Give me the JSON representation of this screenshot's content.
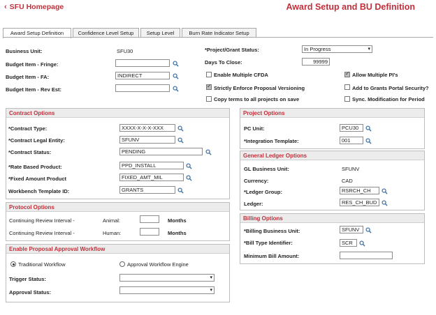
{
  "header": {
    "home_link": "SFU Homepage",
    "page_title": "Award Setup and BU Definition"
  },
  "tabs": [
    {
      "label": "Award Setup Definition",
      "active": true
    },
    {
      "label": "Confidence Level Setup",
      "active": false
    },
    {
      "label": "Setup Level",
      "active": false
    },
    {
      "label": "Burn Rate Indicator Setup",
      "active": false
    }
  ],
  "general": {
    "business_unit_label": "Business Unit:",
    "business_unit_value": "SFU30",
    "budget_fringe_label": "Budget Item - Fringe:",
    "budget_fringe_value": "",
    "budget_fa_label": "Budget Item - FA:",
    "budget_fa_value": "INDIRECT",
    "budget_rev_label": "Budget Item - Rev Est:",
    "budget_rev_value": "",
    "project_status_label": "*Project/Grant Status:",
    "project_status_value": "In Progress",
    "days_to_close_label": "Days To Close:",
    "days_to_close_value": "99999",
    "enable_multiple_cfda_label": "Enable Multiple CFDA",
    "enable_multiple_cfda_checked": false,
    "allow_multiple_pis_label": "Allow Multiple PI's",
    "allow_multiple_pis_checked": true,
    "strict_versioning_label": "Strictly Enforce Proposal Versioning",
    "strict_versioning_checked": true,
    "add_portal_label": "Add to Grants Portal Security?",
    "add_portal_checked": false,
    "copy_terms_label": "Copy terms to all projects on save",
    "copy_terms_checked": false,
    "sync_mod_label": "Sync. Modification for Period",
    "sync_mod_checked": false
  },
  "contract_options": {
    "title": "Contract Options",
    "contract_type_label": "*Contract Type:",
    "contract_type_value": "XXXX-X-X-X-XXX",
    "legal_entity_label": "*Contract Legal Entity:",
    "legal_entity_value": "SFUNV",
    "contract_status_label": "*Contract Status:",
    "contract_status_value": "PENDING",
    "rate_based_label": "*Rate Based Product:",
    "rate_based_value": "PPD_INSTALL",
    "fixed_amount_label": "*Fixed Amount Product",
    "fixed_amount_value": "FIXED_AMT_MIL",
    "workbench_label": "Workbench Template ID:",
    "workbench_value": "GRANTS"
  },
  "protocol_options": {
    "title": "Protocol Options",
    "row1_label": "Continuing Review Interval -",
    "row1_sub": "Animal:",
    "row1_value": "",
    "row1_unit": "Months",
    "row2_label": "Continuing Review Interval -",
    "row2_sub": "Human:",
    "row2_value": "",
    "row2_unit": "Months"
  },
  "workflow": {
    "title": "Enable Proposal Approval Workflow",
    "traditional_label": "Traditional Workflow",
    "traditional_selected": true,
    "engine_label": "Approval Workflow Engine",
    "engine_selected": false,
    "trigger_label": "Trigger Status:",
    "trigger_value": "",
    "approval_label": "Approval Status:",
    "approval_value": ""
  },
  "project_options": {
    "title": "Project Options",
    "pc_unit_label": "PC Unit:",
    "pc_unit_value": "PCU30",
    "integration_label": "*Integration Template:",
    "integration_value": "001"
  },
  "gl_options": {
    "title": "General Ledger Options",
    "gl_bu_label": "GL Business Unit:",
    "gl_bu_value": "SFUNV",
    "currency_label": "Currency:",
    "currency_value": "CAD",
    "ledger_group_label": "*Ledger Group:",
    "ledger_group_value": "RSRCH_CH",
    "ledger_label": "Ledger:",
    "ledger_value": "RES_CH_BUD"
  },
  "billing_options": {
    "title": "Billing Options",
    "billing_bu_label": "*Billing Business Unit:",
    "billing_bu_value": "SFUNV",
    "bill_type_label": "*Bill Type Identifier:",
    "bill_type_value": "SCR",
    "min_bill_label": "Minimum Bill Amount:",
    "min_bill_value": ""
  },
  "colors": {
    "accent": "#c0303a",
    "header_bg": "#ececec"
  },
  "icons": {
    "lookup": "magnifier-icon",
    "back": "chevron-left-icon",
    "dropdown": "chevron-down-icon"
  }
}
